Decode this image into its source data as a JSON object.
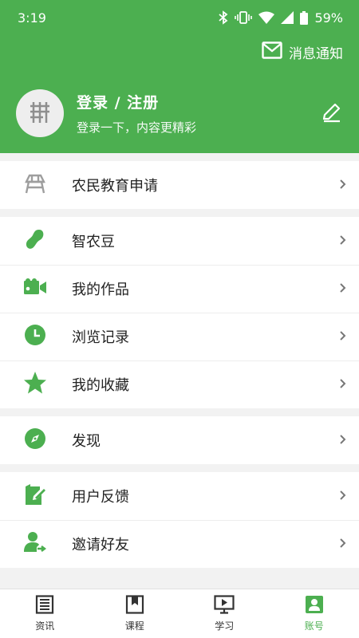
{
  "status": {
    "time": "3:19",
    "battery": "59%"
  },
  "header": {
    "notice_label": "消息通知",
    "login_label": "登录 / 注册",
    "subtitle": "登录一下，内容更精彩"
  },
  "menu": {
    "groups": [
      {
        "items": [
          {
            "label": "农民教育申请",
            "icon": "farmer-education-icon"
          }
        ]
      },
      {
        "items": [
          {
            "label": "智农豆",
            "icon": "bean-icon"
          },
          {
            "label": "我的作品",
            "icon": "video-camera-icon"
          },
          {
            "label": "浏览记录",
            "icon": "clock-icon"
          },
          {
            "label": "我的收藏",
            "icon": "star-icon"
          }
        ]
      },
      {
        "items": [
          {
            "label": "发现",
            "icon": "compass-icon"
          }
        ]
      },
      {
        "items": [
          {
            "label": "用户反馈",
            "icon": "feedback-icon"
          },
          {
            "label": "邀请好友",
            "icon": "invite-friend-icon"
          }
        ]
      }
    ]
  },
  "tabs": [
    {
      "label": "资讯",
      "icon": "news-icon"
    },
    {
      "label": "课程",
      "icon": "book-icon"
    },
    {
      "label": "学习",
      "icon": "play-screen-icon"
    },
    {
      "label": "账号",
      "icon": "account-icon",
      "active": true
    }
  ],
  "colors": {
    "accent": "#4caf50",
    "icon_gray": "#9e9e9e"
  }
}
